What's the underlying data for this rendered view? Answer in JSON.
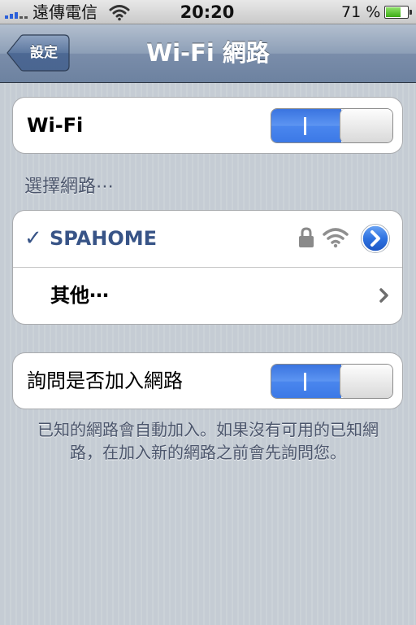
{
  "status_bar": {
    "carrier": "遠傳電信",
    "time": "20:20",
    "battery_percent_text": "71 %",
    "battery_level": 0.71,
    "icons": [
      "signal-icon",
      "wifi-icon",
      "battery-icon"
    ]
  },
  "nav": {
    "back_label": "設定",
    "title": "Wi-Fi 網路"
  },
  "wifi_group": {
    "label": "Wi-Fi",
    "toggle_on": true
  },
  "networks_header": "選擇網路⋯",
  "networks": {
    "checkmark": "✓",
    "selected": "SPAHOME",
    "other": "其他⋯",
    "icons": [
      "lock-icon",
      "wifi-icon",
      "detail-disclosure-icon",
      "chevron-right-icon"
    ]
  },
  "ask_group": {
    "label": "詢問是否加入網路",
    "toggle_on": true
  },
  "footer": "已知的網路會自動加入。如果沒有可用的已知網路，在加入新的網路之前會先詢問您。",
  "colors": {
    "toggle_blue": "#3c79e6",
    "selected_text": "#385487",
    "group_text": "#4c566c"
  }
}
